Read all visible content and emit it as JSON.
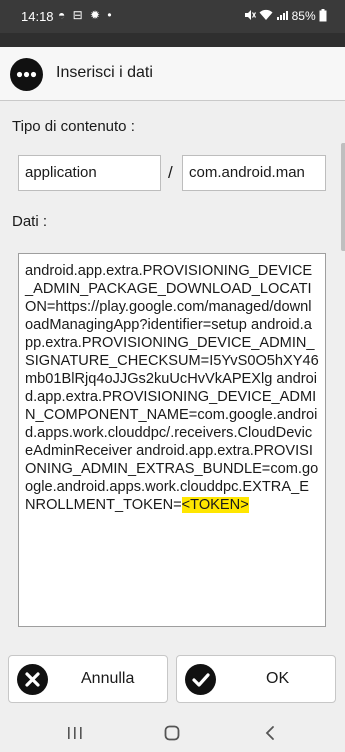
{
  "status": {
    "time": "14:18",
    "left_icons": "◓ ⊟ ✹ •",
    "battery": "85%"
  },
  "dialog": {
    "title": "Inserisci i dati",
    "content_type_label": "Tipo di contenuto :",
    "mime_major": "application",
    "separator": "/",
    "mime_minor": "com.android.man",
    "data_label": "Dati :",
    "data_text": "android.app.extra.PROVISIONING_DEVICE_ADMIN_PACKAGE_DOWNLOAD_LOCATION=https://play.google.com/managed/downloadManagingApp?identifier=setup android.app.extra.PROVISIONING_DEVICE_ADMIN_SIGNATURE_CHECKSUM=I5YvS0O5hXY46mb01BlRjq4oJJGs2kuUcHvVkAPEXlg android.app.extra.PROVISIONING_DEVICE_ADMIN_COMPONENT_NAME=com.google.android.apps.work.clouddpc/.receivers.CloudDeviceAdminReceiver android.app.extra.PROVISIONING_ADMIN_EXTRAS_BUNDLE=com.google.android.apps.work.clouddpc.EXTRA_ENROLLMENT_TOKEN=",
    "data_token": "<TOKEN>",
    "cancel_label": "Annulla",
    "ok_label": "OK"
  },
  "nav": {
    "recents": "|||",
    "home": "○",
    "back": "<"
  }
}
